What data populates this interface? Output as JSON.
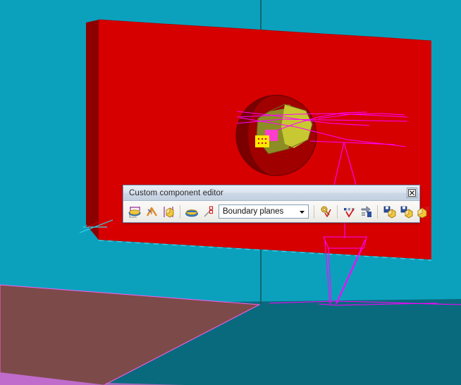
{
  "window": {
    "title": "Custom component editor",
    "close_label": "☒",
    "close_icon": "close-box-icon"
  },
  "toolbar": {
    "buttons": [
      {
        "name": "insert-construction-plane-button",
        "icon": "construction-plane-icon",
        "tooltip": "Construction plane"
      },
      {
        "name": "insert-construction-line-button",
        "icon": "construction-line-icon",
        "tooltip": "Construction line"
      },
      {
        "name": "insert-construction-circle-button",
        "icon": "construction-circle-icon",
        "tooltip": "Construction circle"
      },
      {
        "name": "reference-plane-button",
        "icon": "reference-plane-icon",
        "tooltip": "Reference plane"
      },
      {
        "name": "reference-line-button",
        "icon": "reference-line-icon",
        "tooltip": "Reference line"
      }
    ],
    "dropdown": {
      "name": "display-mode-dropdown",
      "value": "Boundary planes",
      "arrow_icon": "chevron-down-icon",
      "options": [
        "Boundary planes"
      ]
    },
    "buttons_right": [
      {
        "name": "bind-variable-button",
        "icon": "bind-variable-icon",
        "tooltip": "Bind"
      },
      {
        "name": "check-points-button",
        "icon": "check-points-icon",
        "tooltip": "Check points"
      },
      {
        "name": "apply-direction-button",
        "icon": "apply-direction-icon",
        "tooltip": "Direction"
      },
      {
        "name": "save-component-button",
        "icon": "save-box-icon",
        "tooltip": "Save"
      },
      {
        "name": "save-as-component-button",
        "icon": "save-box-alt-icon",
        "tooltip": "Save as"
      },
      {
        "name": "delete-component-button",
        "icon": "delete-box-icon",
        "tooltip": "Delete"
      }
    ]
  },
  "scene": {
    "name": "custom-component-3d-view",
    "background_color": "#0ba1bd",
    "colors": {
      "background": "#0ba1bd",
      "slab_front": "#d60000",
      "slab_side": "#8c0000",
      "slab_bottom": "#6e0000",
      "sphere_dark": "#a00000",
      "sphere_light": "#c8c832",
      "sphere_shade": "#8d8d25",
      "wire_magenta": "#ff00ff",
      "wire_cyan": "#00e5ff",
      "ground_near": "#0a6a7d",
      "ground_brown": "#7d4a4a",
      "ground_violet": "#c06ccc",
      "axis_line": "#1b4a52",
      "marker_yellow": "#ffe800",
      "marker_magenta": "#ff3ccf"
    },
    "markers": [
      {
        "name": "yellow-node-marker",
        "color": "#ffe800"
      },
      {
        "name": "magenta-node-marker",
        "color": "#ff3ccf"
      }
    ]
  }
}
